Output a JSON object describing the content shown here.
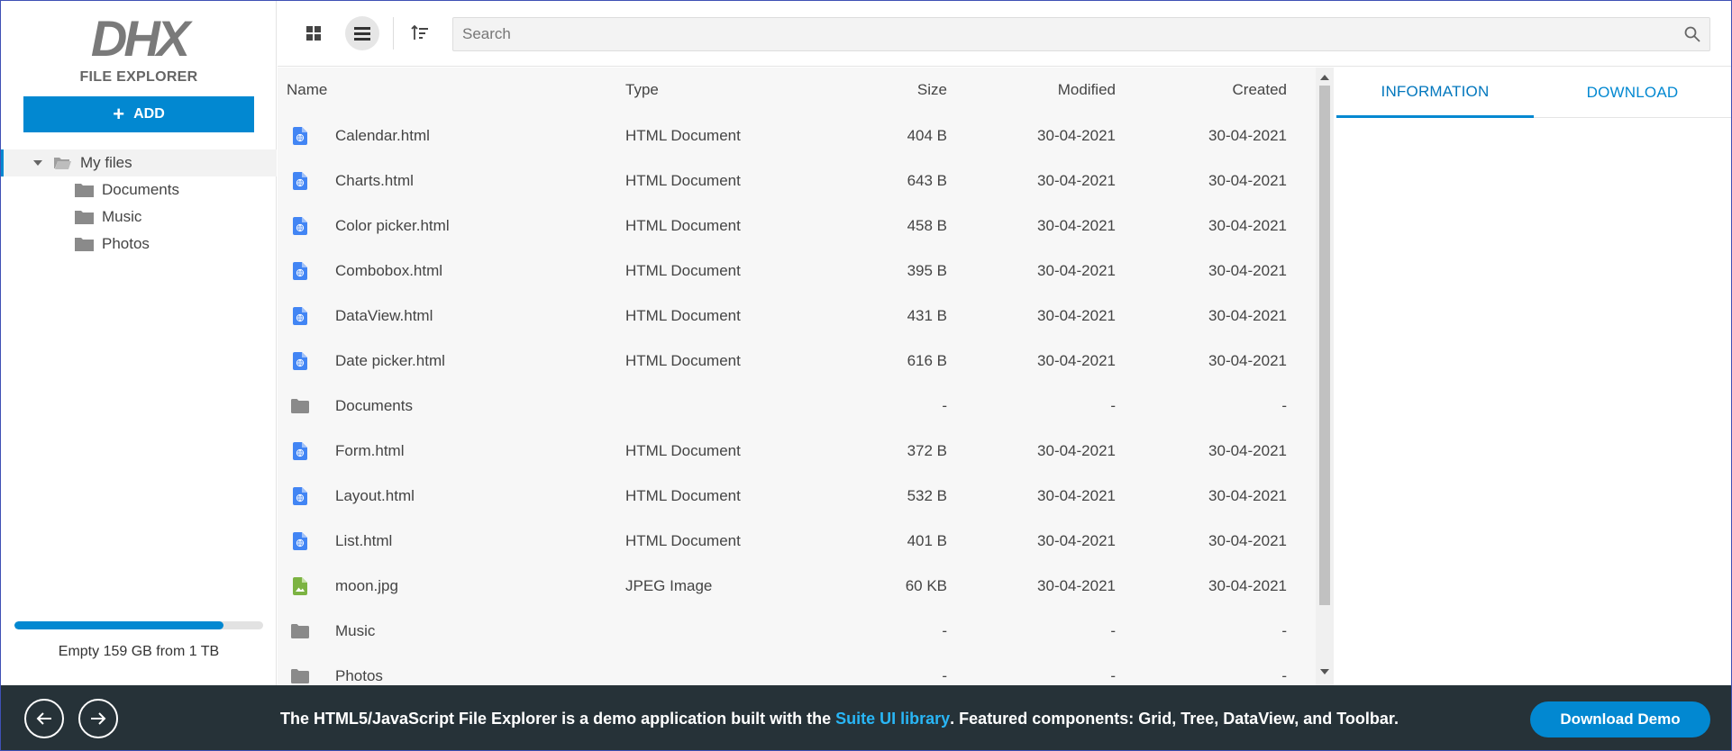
{
  "brand": {
    "logo_mark": "DHX",
    "logo_sub": "FILE EXPLORER"
  },
  "sidebar": {
    "add_label": "ADD",
    "tree": {
      "root": "My files",
      "children": [
        "Documents",
        "Music",
        "Photos"
      ]
    },
    "storage": {
      "text": "Empty 159 GB from 1 TB",
      "used_fraction": 0.84
    }
  },
  "toolbar": {
    "view_mode": "list",
    "search_placeholder": "Search",
    "search_value": ""
  },
  "grid": {
    "columns": {
      "name": "Name",
      "type": "Type",
      "size": "Size",
      "modified": "Modified",
      "created": "Created"
    },
    "rows": [
      {
        "icon": "html-file-icon",
        "name": "Calendar.html",
        "type": "HTML Document",
        "size": "404 B",
        "modified": "30-04-2021",
        "created": "30-04-2021"
      },
      {
        "icon": "html-file-icon",
        "name": "Charts.html",
        "type": "HTML Document",
        "size": "643 B",
        "modified": "30-04-2021",
        "created": "30-04-2021"
      },
      {
        "icon": "html-file-icon",
        "name": "Color picker.html",
        "type": "HTML Document",
        "size": "458 B",
        "modified": "30-04-2021",
        "created": "30-04-2021"
      },
      {
        "icon": "html-file-icon",
        "name": "Combobox.html",
        "type": "HTML Document",
        "size": "395 B",
        "modified": "30-04-2021",
        "created": "30-04-2021"
      },
      {
        "icon": "html-file-icon",
        "name": "DataView.html",
        "type": "HTML Document",
        "size": "431 B",
        "modified": "30-04-2021",
        "created": "30-04-2021"
      },
      {
        "icon": "html-file-icon",
        "name": "Date picker.html",
        "type": "HTML Document",
        "size": "616 B",
        "modified": "30-04-2021",
        "created": "30-04-2021"
      },
      {
        "icon": "folder-icon",
        "name": "Documents",
        "type": "",
        "size": "-",
        "modified": "-",
        "created": "-"
      },
      {
        "icon": "html-file-icon",
        "name": "Form.html",
        "type": "HTML Document",
        "size": "372 B",
        "modified": "30-04-2021",
        "created": "30-04-2021"
      },
      {
        "icon": "html-file-icon",
        "name": "Layout.html",
        "type": "HTML Document",
        "size": "532 B",
        "modified": "30-04-2021",
        "created": "30-04-2021"
      },
      {
        "icon": "html-file-icon",
        "name": "List.html",
        "type": "HTML Document",
        "size": "401 B",
        "modified": "30-04-2021",
        "created": "30-04-2021"
      },
      {
        "icon": "image-file-icon",
        "name": "moon.jpg",
        "type": "JPEG Image",
        "size": "60 KB",
        "modified": "30-04-2021",
        "created": "30-04-2021"
      },
      {
        "icon": "folder-icon",
        "name": "Music",
        "type": "",
        "size": "-",
        "modified": "-",
        "created": "-"
      },
      {
        "icon": "folder-icon",
        "name": "Photos",
        "type": "",
        "size": "-",
        "modified": "-",
        "created": "-"
      }
    ]
  },
  "panel": {
    "tabs": [
      "INFORMATION",
      "DOWNLOAD"
    ],
    "active_tab": "INFORMATION"
  },
  "footer": {
    "text_before": "The HTML5/JavaScript File Explorer is a demo application built with the ",
    "link_text": "Suite UI library",
    "text_after": ". Featured components: Grid, Tree, DataView, and Toolbar.",
    "button_label": "Download Demo"
  },
  "colors": {
    "accent": "#0288d1",
    "footer_bg": "#263238",
    "link": "#29b6f6",
    "html_icon": "#4285f4",
    "image_icon": "#7cb342",
    "folder_icon": "#8a8a8a"
  }
}
